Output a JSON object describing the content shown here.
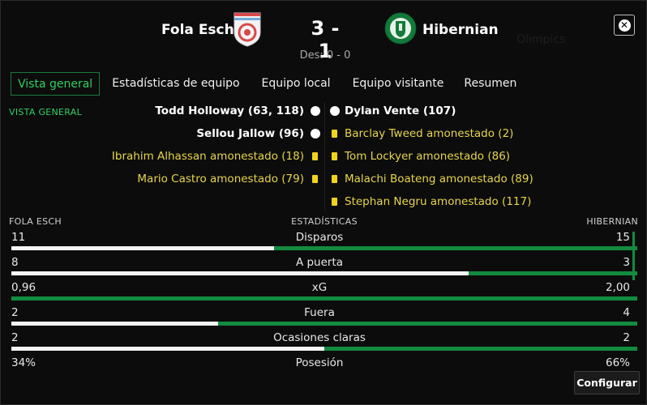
{
  "header": {
    "home_team": "Fola Esch",
    "away_team": "Hibernian",
    "score": "3 - 1",
    "halftime": "Des: 0 - 0"
  },
  "tabs": [
    {
      "label": "Vista general",
      "active": true
    },
    {
      "label": "Estadísticas de equipo"
    },
    {
      "label": "Equipo local"
    },
    {
      "label": "Equipo visitante"
    },
    {
      "label": "Resumen"
    }
  ],
  "section_label": "VISTA GENERAL",
  "events": {
    "home": [
      {
        "text": "Todd Holloway (63, 118)",
        "type": "goal"
      },
      {
        "text": "Sellou Jallow (96)",
        "type": "goal"
      },
      {
        "text": "Ibrahim Alhassan amonestado (18)",
        "type": "card"
      },
      {
        "text": "Mario Castro amonestado (79)",
        "type": "card"
      }
    ],
    "away": [
      {
        "text": "Dylan Vente (107)",
        "type": "goal"
      },
      {
        "text": "Barclay Tweed amonestado (2)",
        "type": "card"
      },
      {
        "text": "Tom Lockyer amonestado (86)",
        "type": "card"
      },
      {
        "text": "Malachi Boateng amonestado (89)",
        "type": "card"
      },
      {
        "text": "Stephan Negru amonestado (117)",
        "type": "card"
      }
    ]
  },
  "stats_header": {
    "home": "FOLA ESCH",
    "center": "ESTADÍSTICAS",
    "away": "HIBERNIAN"
  },
  "stats": [
    {
      "name": "Disparos",
      "home": "11",
      "away": "15",
      "home_share": 0.42
    },
    {
      "name": "A puerta",
      "home": "8",
      "away": "3",
      "home_share": 0.73
    },
    {
      "name": "xG",
      "home": "0,96",
      "away": "2,00",
      "home_share": 0.0
    },
    {
      "name": "Fuera",
      "home": "2",
      "away": "4",
      "home_share": 0.33
    },
    {
      "name": "Ocasiones claras",
      "home": "2",
      "away": "2",
      "home_share": 0.5
    },
    {
      "name": "Posesión",
      "home": "34%",
      "away": "66%"
    }
  ],
  "config_button": "Configurar",
  "colors": {
    "accent_green": "#2fcf60",
    "bar_green": "#138b3e",
    "card_yellow": "#f1d31c"
  }
}
